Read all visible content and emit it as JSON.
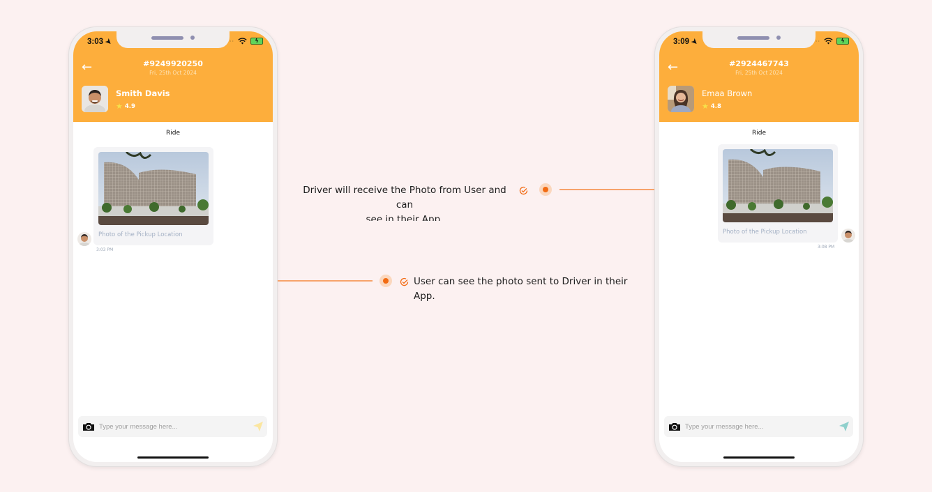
{
  "phones": [
    {
      "role": "user-app",
      "status_time": "3:03",
      "order_number": "#9249920250",
      "order_date": "Fri, 25th Oct 2024",
      "contact_name": "Smith Davis",
      "rating": "4.9",
      "section_title": "Ride",
      "message": {
        "caption": "Photo of the Pickup Location",
        "time": "3:03 PM",
        "alignment": "left"
      },
      "input_placeholder": "Type your message here...",
      "send_color": "#fbe6a0"
    },
    {
      "role": "driver-app",
      "status_time": "3:09",
      "order_number": "#2924467743",
      "order_date": "Fri, 25th Oct 2024",
      "contact_name": "Emaa Brown",
      "rating": "4.8",
      "section_title": "Ride",
      "message": {
        "caption": "Photo of the Pickup Location",
        "time": "3:08 PM",
        "alignment": "right"
      },
      "input_placeholder": "Type your message here...",
      "send_color": "#8fd0cc"
    }
  ],
  "callouts": {
    "driver": "Driver will receive the Photo from User and can see in their App.",
    "driver_line1": "Driver will receive the Photo from User and can",
    "driver_line2": "see in their App.",
    "user_line1": "User can see the photo sent to Driver in their",
    "user_line2": "App."
  },
  "colors": {
    "background": "#fcf1f1",
    "header": "#fdae3c",
    "accent": "#f26b13",
    "connector": "#f7a36a"
  }
}
